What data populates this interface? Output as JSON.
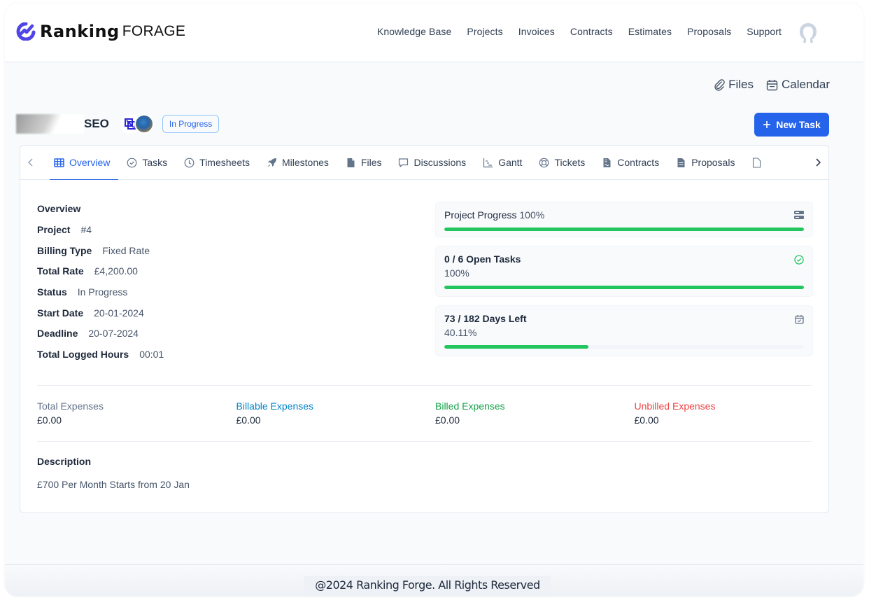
{
  "brand": {
    "name_bold": "Ranking",
    "name_light": "FORAGE",
    "accent_color": "#4f46e5"
  },
  "nav": {
    "items": [
      {
        "label": "Knowledge Base"
      },
      {
        "label": "Projects"
      },
      {
        "label": "Invoices"
      },
      {
        "label": "Contracts"
      },
      {
        "label": "Estimates"
      },
      {
        "label": "Proposals"
      },
      {
        "label": "Support"
      }
    ],
    "avatar_icon": "user-avatar-icon"
  },
  "toolbar": {
    "files_label": "Files",
    "calendar_label": "Calendar",
    "new_task_label": "New Task"
  },
  "project": {
    "title_suffix": "SEO",
    "status_badge": "In Progress",
    "status_color": "#2563eb"
  },
  "tabs": [
    {
      "label": "Overview",
      "icon": "grid-icon",
      "active": true
    },
    {
      "label": "Tasks",
      "icon": "check-circle-icon"
    },
    {
      "label": "Timesheets",
      "icon": "clock-icon"
    },
    {
      "label": "Milestones",
      "icon": "rocket-icon"
    },
    {
      "label": "Files",
      "icon": "file-icon"
    },
    {
      "label": "Discussions",
      "icon": "chat-icon"
    },
    {
      "label": "Gantt",
      "icon": "gantt-icon"
    },
    {
      "label": "Tickets",
      "icon": "lifebuoy-icon"
    },
    {
      "label": "Contracts",
      "icon": "contract-icon"
    },
    {
      "label": "Proposals",
      "icon": "document-icon"
    }
  ],
  "overview": {
    "heading": "Overview",
    "rows": [
      {
        "label": "Project",
        "value": "#4"
      },
      {
        "label": "Billing Type",
        "value": "Fixed Rate"
      },
      {
        "label": "Total Rate",
        "value": "£4,200.00"
      },
      {
        "label": "Status",
        "value": "In Progress"
      },
      {
        "label": "Start Date",
        "value": "20-01-2024"
      },
      {
        "label": "Deadline",
        "value": "20-07-2024"
      },
      {
        "label": "Total Logged Hours",
        "value": "00:01"
      }
    ]
  },
  "stats": {
    "project_progress": {
      "label": "Project Progress",
      "percent_text": "100%",
      "value": 100
    },
    "open_tasks": {
      "label": "0 / 6 Open Tasks",
      "percent_text": "100%",
      "value": 100
    },
    "days_left": {
      "label": "73 / 182 Days Left",
      "percent_text": "40.11%",
      "value": 40.11
    },
    "bar_color": "#22c55e"
  },
  "expenses": [
    {
      "label": "Total Expenses",
      "value": "£0.00",
      "color": "#64748b"
    },
    {
      "label": "Billable Expenses",
      "value": "£0.00",
      "color": "#0284c7"
    },
    {
      "label": "Billed Expenses",
      "value": "£0.00",
      "color": "#16a34a"
    },
    {
      "label": "Unbilled Expenses",
      "value": "£0.00",
      "color": "#ef4444"
    }
  ],
  "description": {
    "heading": "Description",
    "text": "£700 Per Month Starts from 20 Jan"
  },
  "footer": {
    "text": "@2024 Ranking Forge. All Rights Reserved"
  }
}
